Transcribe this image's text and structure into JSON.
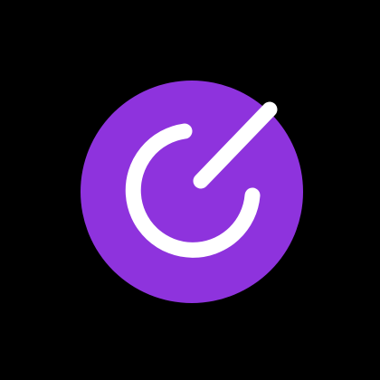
{
  "app_icon": {
    "icon_name": "circular-arrow-logo-icon",
    "colors": {
      "background": "#000000",
      "badge": "#8e33dd",
      "glyph": "#ffffff"
    }
  }
}
